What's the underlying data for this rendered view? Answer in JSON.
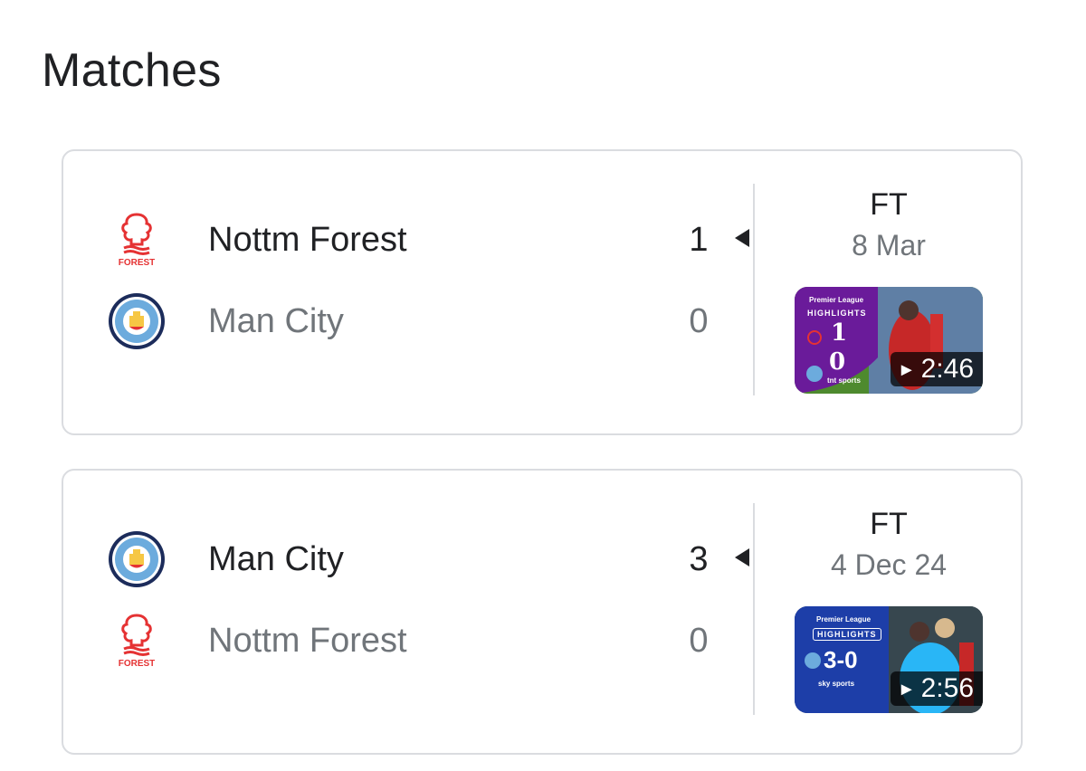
{
  "section_title": "Matches",
  "matches": [
    {
      "home_team": "Nottm Forest",
      "home_score": "1",
      "away_team": "Man City",
      "away_score": "0",
      "status": "FT",
      "date": "8 Mar",
      "highlight": {
        "league": "Premier League",
        "label": "HIGHLIGHTS",
        "top_score": "1",
        "bottom_score": "0",
        "broadcaster": "tnt sports",
        "duration": "2:46"
      }
    },
    {
      "home_team": "Man City",
      "home_score": "3",
      "away_team": "Nottm Forest",
      "away_score": "0",
      "status": "FT",
      "date": "4 Dec 24",
      "highlight": {
        "league": "Premier League",
        "label": "HIGHLIGHTS",
        "score_line": "3-0",
        "broadcaster": "sky sports",
        "duration": "2:56"
      }
    }
  ],
  "icons": {
    "forest_crest": "nottm-forest-crest-icon",
    "city_crest": "man-city-crest-icon",
    "winner_marker": "winner-arrow-icon",
    "play": "play-icon"
  },
  "colors": {
    "forest_red": "#e53233",
    "city_blue": "#6cabdd",
    "city_navy": "#1c2c5b",
    "tnt_purple": "#6a1b9a",
    "sky_blue": "#1d3ea8",
    "muted_text": "#70757a",
    "border": "#dadce0"
  }
}
